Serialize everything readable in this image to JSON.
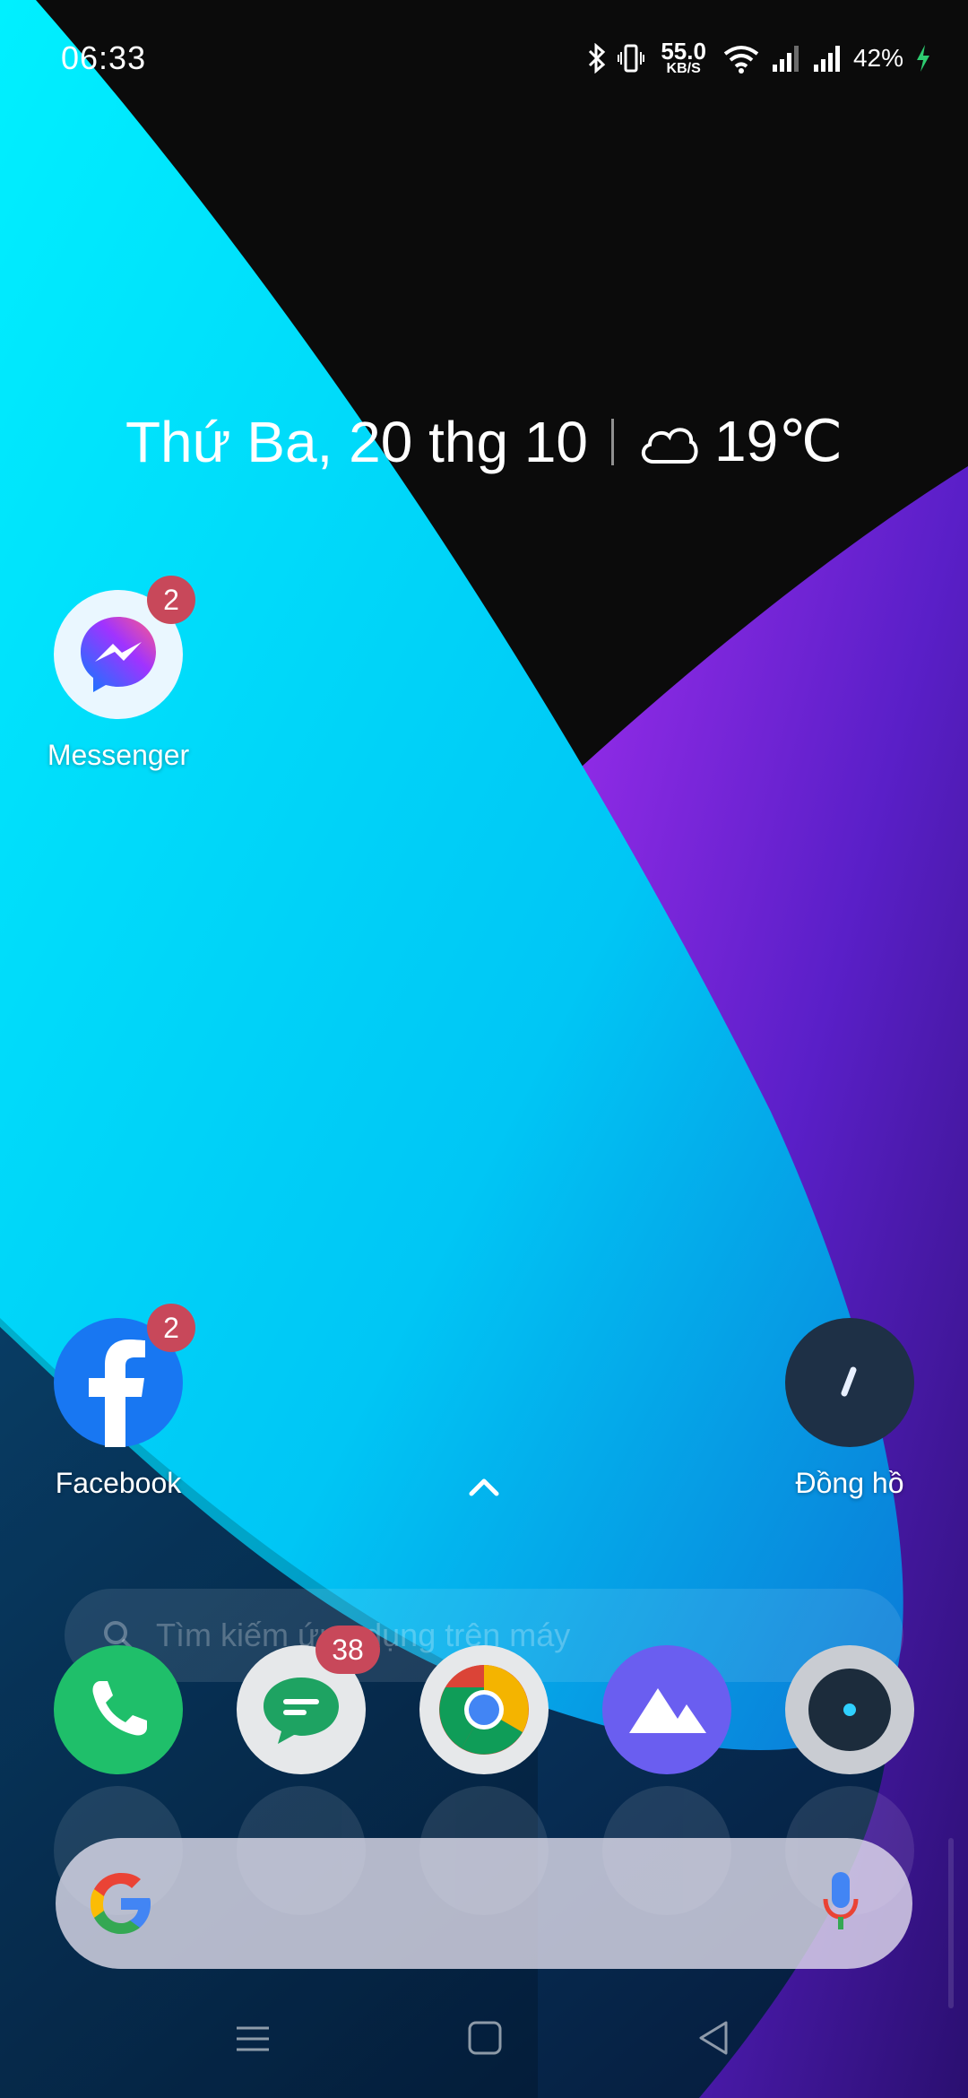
{
  "status_bar": {
    "time": "06:33",
    "net_speed_value": "55.0",
    "net_speed_unit": "KB/S",
    "battery_percent": "42%",
    "icons": [
      "bluetooth-icon",
      "vibrate-icon",
      "wifi-icon",
      "signal-icon",
      "signal-icon",
      "battery-charging-icon"
    ]
  },
  "widget": {
    "date": "Thứ Ba, 20 thg 10",
    "temperature": "19℃",
    "weather_icon": "cloudy-icon"
  },
  "apps": {
    "messenger": {
      "label": "Messenger",
      "badge": "2"
    },
    "facebook": {
      "label": "Facebook",
      "badge": "2"
    },
    "clock": {
      "label": "Đồng hồ"
    }
  },
  "drawer_search": {
    "placeholder": "Tìm kiếm ứng dụng trên máy"
  },
  "dock": {
    "messages_badge": "38",
    "items": [
      "phone-icon",
      "messages-icon",
      "chrome-icon",
      "gallery-icon",
      "camera-icon"
    ]
  },
  "google_search": {
    "logo": "google-g-icon",
    "mic": "mic-icon"
  },
  "nav_bar": [
    "recents-icon",
    "home-icon",
    "back-icon"
  ],
  "colors": {
    "wallpaper_cyan": "#00e5ff",
    "wallpaper_purple": "#7b2ee6",
    "wallpaper_dark": "#0d0d0d",
    "badge": "#c8485a",
    "phone_green": "#1fbf6a",
    "gallery_purple": "#6a5ef0"
  }
}
